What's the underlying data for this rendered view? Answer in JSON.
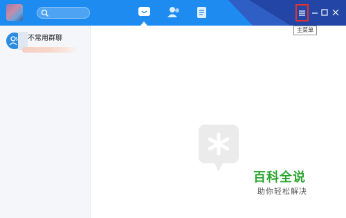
{
  "titlebar": {
    "accent": "#1d8bf0",
    "dark_band": "#2346a6",
    "tooltip_text": "主菜单",
    "icons": [
      "message-icon",
      "contacts-icon",
      "notes-icon",
      "menu-icon",
      "minimize-icon",
      "maximize-icon",
      "close-icon"
    ]
  },
  "sidebar": {
    "group_label": "不常用群聊"
  },
  "watermark": {
    "title": "百科全说",
    "subtitle": "助你轻松解决",
    "color": "#2aa52f"
  }
}
